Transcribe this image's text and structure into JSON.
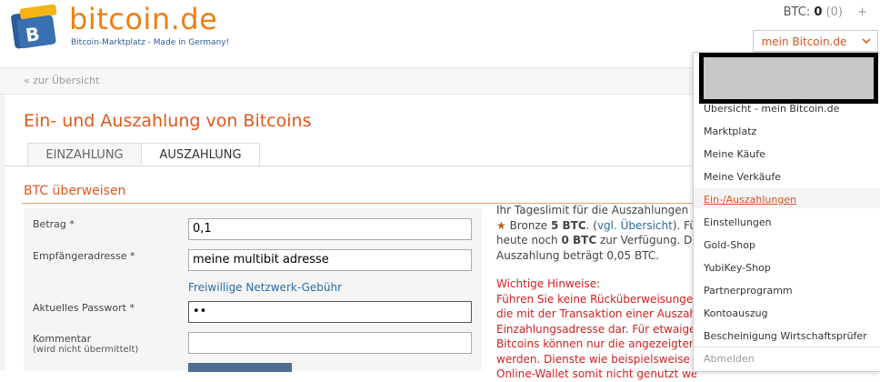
{
  "brand": {
    "name": "bitcoin.de",
    "tagline": "Bitcoin-Marktplatz - Made in Germany!"
  },
  "header": {
    "balance_label": "BTC:",
    "balance_value": "0",
    "balance_pending": "(0)",
    "add_symbol": "+",
    "account_button": "mein Bitcoin.de"
  },
  "breadcrumb": "« zur Übersicht",
  "page": {
    "title": "Ein- und Auszahlung von Bitcoins",
    "tabs": [
      {
        "label": "EINZAHLUNG",
        "active": false
      },
      {
        "label": "AUSZAHLUNG",
        "active": true
      }
    ],
    "section_title": "BTC überweisen"
  },
  "form": {
    "amount_label": "Betrag",
    "amount_value": "0,1",
    "address_label": "Empfängeradresse",
    "address_value": "meine multibit adresse",
    "fee_link": "Freiwillige Netzwerk-Gebühr",
    "password_label": "Aktuelles Passwort",
    "password_value": "••",
    "comment_label": "Kommentar",
    "comment_sublabel": "(wird nicht übermittelt)",
    "comment_value": "",
    "required_mark": "*"
  },
  "info": {
    "line1": "Ihr Tageslimit für die Auszahlungen b",
    "line2_prefix": "Bronze ",
    "line2_bold": "5 BTC",
    "line2_mid": ". (",
    "line2_link": "vgl. Übersicht",
    "line2_suffix": "). Fü",
    "line3_prefix": "heute noch ",
    "line3_bold": "0 BTC",
    "line3_suffix": " zur Verfügung. Die",
    "line4": "Auszahlung beträgt 0,05 BTC."
  },
  "warnings": {
    "heading": "Wichtige Hinweise:",
    "lines": [
      "Führen Sie keine Rücküberweisungen",
      "die mit der Transaktion einer Auszahl",
      "Einzahlungsadresse dar. Für etwaige (",
      "Bitcoins können nur die angezeigten",
      "werden. Dienste wie beispielsweise S",
      "Online-Wallet somit nicht genutzt wer"
    ]
  },
  "dropdown": {
    "items": [
      "Übersicht - mein Bitcoin.de",
      "Marktplatz",
      "Meine Käufe",
      "Meine Verkäufe",
      "Ein-/Auszahlungen",
      "Einstellungen",
      "Gold-Shop",
      "YubiKey-Shop",
      "Partnerprogramm",
      "Kontoauszug",
      "Bescheinigung Wirtschaftsprüfer"
    ],
    "logout": "Abmelden"
  },
  "colors": {
    "brand_orange": "#f07e12",
    "heading_orange": "#e0571b",
    "link_blue": "#2b6ca3",
    "warning_red": "#d21f1f"
  }
}
